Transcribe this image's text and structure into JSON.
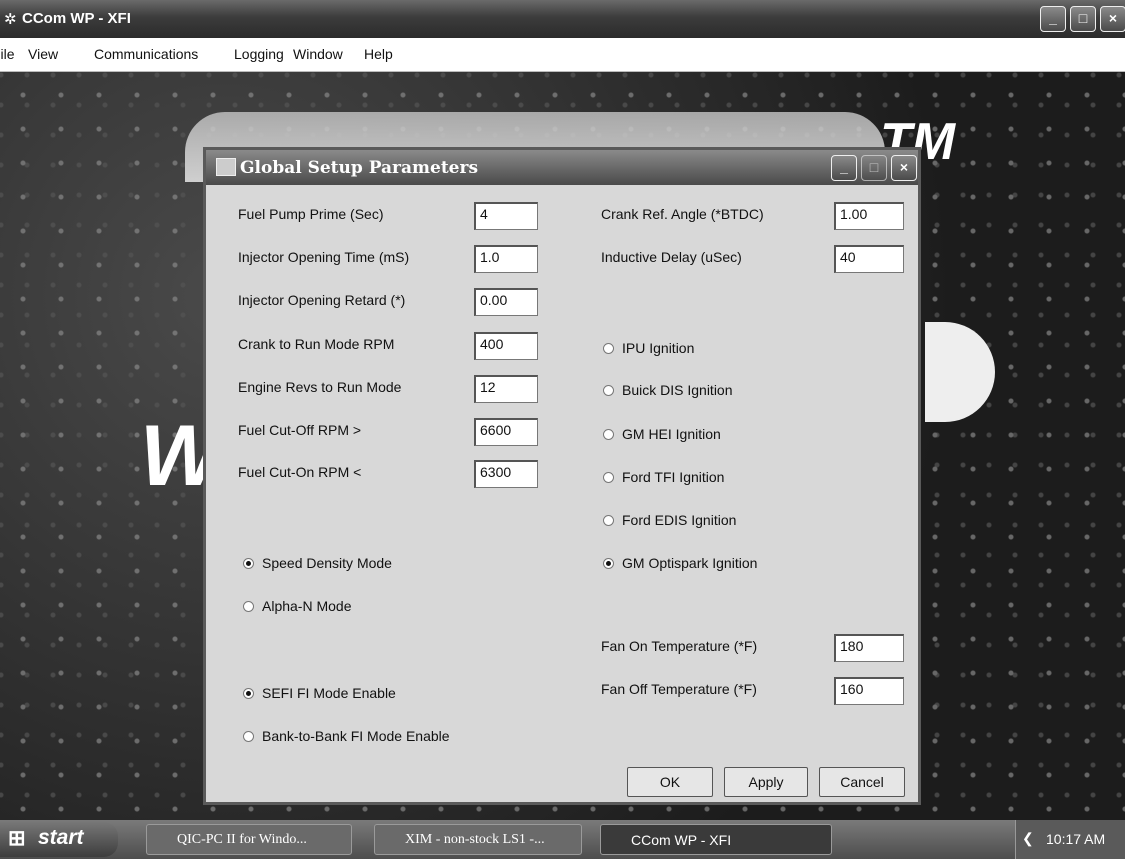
{
  "window": {
    "title": "CCom WP - XFI"
  },
  "menu": [
    "File",
    "View",
    "Communications",
    "Logging",
    "Window",
    "Help"
  ],
  "background": {
    "logo_tm": "TM",
    "logo_w": "W"
  },
  "dialog": {
    "title": "Global Setup Parameters",
    "left_fields": [
      {
        "label": "Fuel Pump Prime (Sec)",
        "value": "4"
      },
      {
        "label": "Injector Opening Time (mS)",
        "value": "1.0"
      },
      {
        "label": "Injector Opening Retard (*)",
        "value": "0.00"
      },
      {
        "label": "Crank to Run Mode RPM",
        "value": "400"
      },
      {
        "label": "Engine Revs to Run Mode",
        "value": "12"
      },
      {
        "label": "Fuel Cut-Off RPM >",
        "value": "6600"
      },
      {
        "label": "Fuel Cut-On RPM <",
        "value": "6300"
      }
    ],
    "right_fields": [
      {
        "label": "Crank Ref. Angle (*BTDC)",
        "value": "1.00"
      },
      {
        "label": "Inductive Delay (uSec)",
        "value": "40"
      }
    ],
    "ignition_options": [
      {
        "label": "IPU Ignition",
        "selected": false
      },
      {
        "label": "Buick DIS Ignition",
        "selected": false
      },
      {
        "label": "GM HEI Ignition",
        "selected": false
      },
      {
        "label": "Ford TFI Ignition",
        "selected": false
      },
      {
        "label": "Ford EDIS Ignition",
        "selected": false
      },
      {
        "label": "GM Optispark Ignition",
        "selected": true
      }
    ],
    "mode_options": [
      {
        "label": "Speed Density Mode",
        "selected": true
      },
      {
        "label": "Alpha-N Mode",
        "selected": false
      }
    ],
    "fi_options": [
      {
        "label": "SEFI FI Mode Enable",
        "selected": true
      },
      {
        "label": "Bank-to-Bank FI Mode Enable",
        "selected": false
      }
    ],
    "fan_fields": [
      {
        "label": "Fan On Temperature (*F)",
        "value": "180"
      },
      {
        "label": "Fan Off Temperature (*F)",
        "value": "160"
      }
    ],
    "buttons": {
      "ok": "OK",
      "apply": "Apply",
      "cancel": "Cancel"
    }
  },
  "taskbar": {
    "start": "start",
    "tasks": [
      "QIC-PC II for Windo...",
      "XIM - non-stock LS1 -...",
      "CCom WP - XFI"
    ],
    "clock": "10:17 AM"
  }
}
